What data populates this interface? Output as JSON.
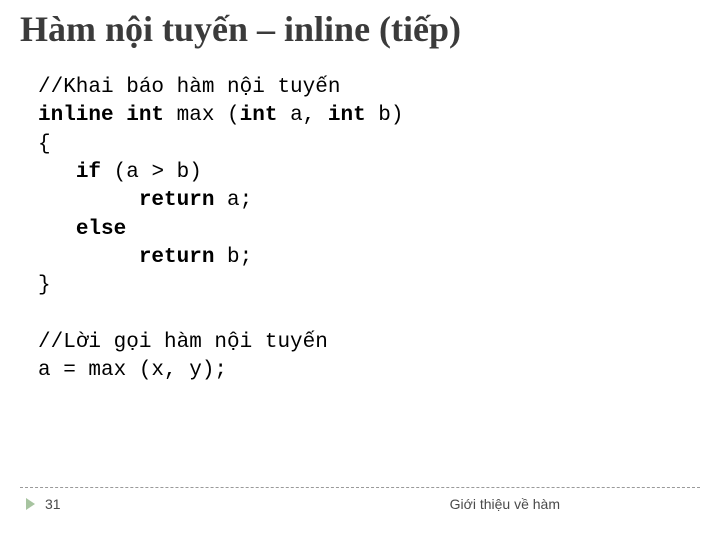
{
  "title": "Hàm nội tuyến – inline (tiếp)",
  "code1": {
    "l1": "//Khai báo hàm nội tuyến",
    "l2a": "inline int",
    "l2b": " max (",
    "l2c": "int",
    "l2d": " a, ",
    "l2e": "int",
    "l2f": " b)",
    "l3": "{",
    "l4a": "   ",
    "l4b": "if",
    "l4c": " (a > b)",
    "l5a": "        ",
    "l5b": "return",
    "l5c": " a;",
    "l6a": "   ",
    "l6b": "else",
    "l7a": "        ",
    "l7b": "return",
    "l7c": " b;",
    "l8": "}"
  },
  "code2": {
    "l1": "//Lời gọi hàm nội tuyến",
    "l2": "a = max (x, y);"
  },
  "footer": {
    "page": "31",
    "text": "Giới thiệu về hàm"
  }
}
